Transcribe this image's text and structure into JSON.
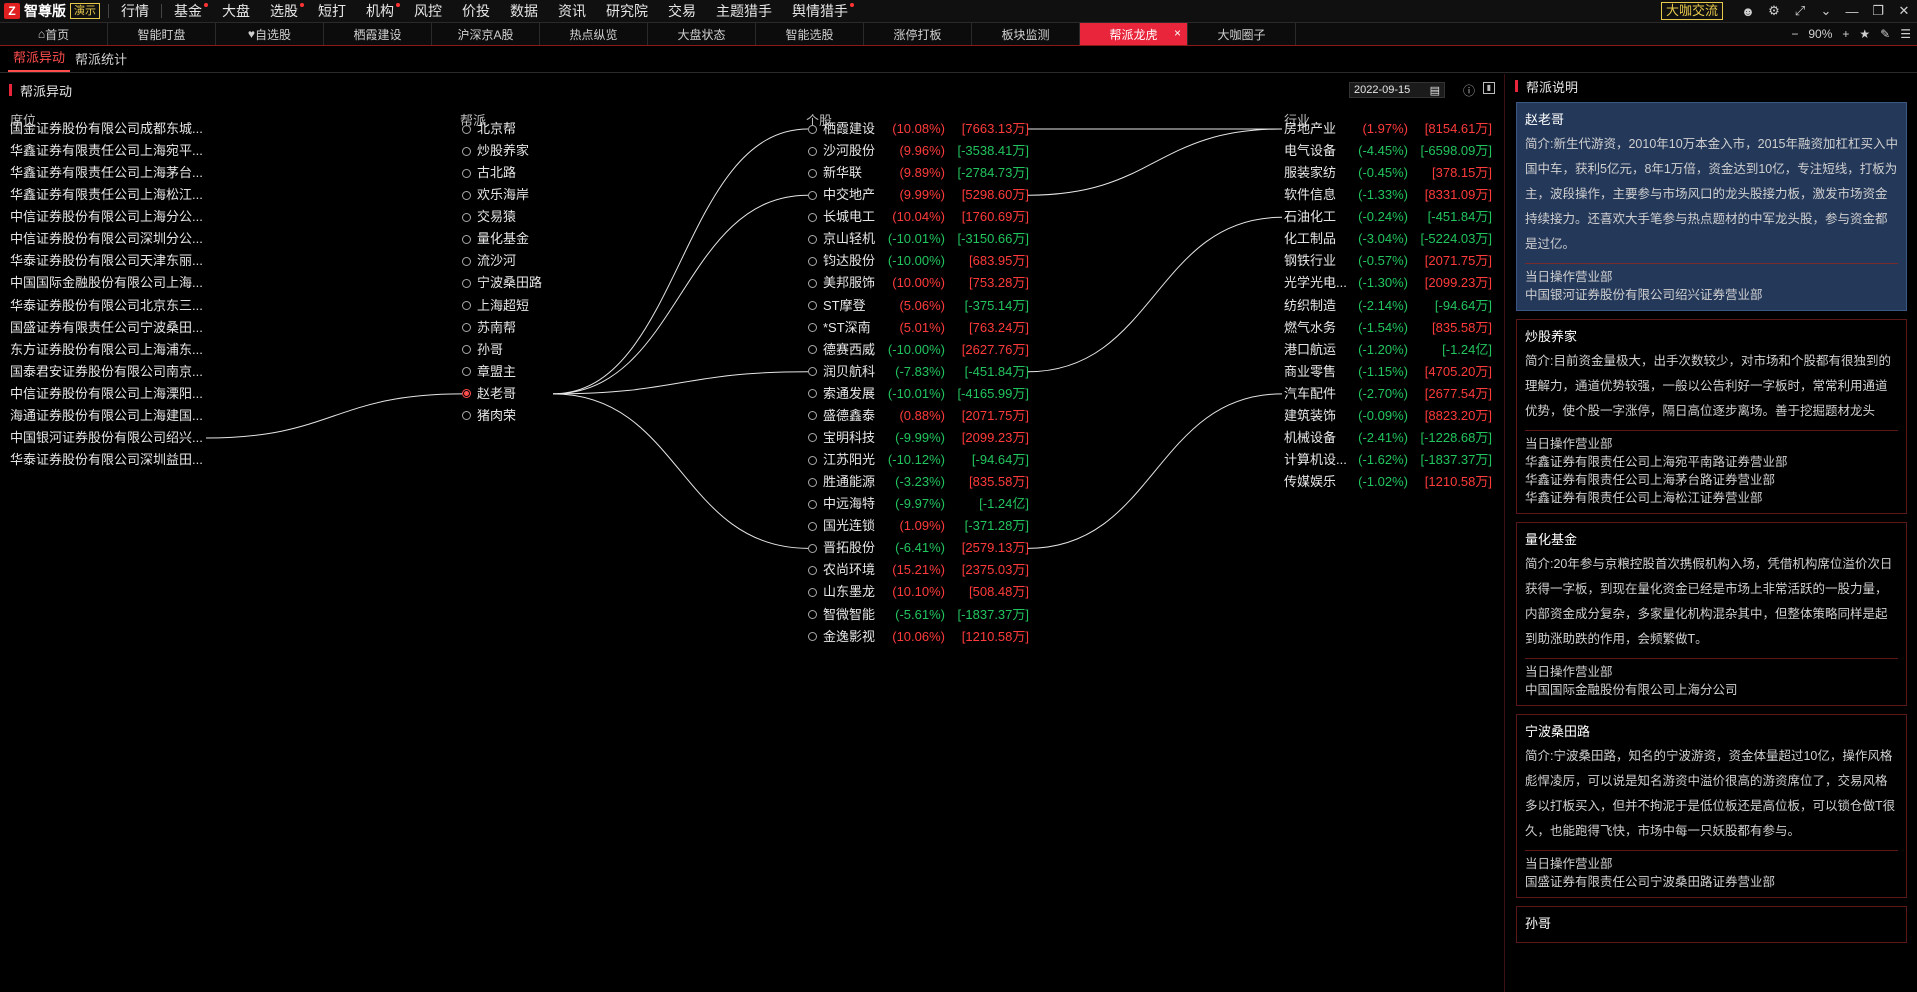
{
  "app": {
    "logo_mark": "Z",
    "name": "智尊版",
    "badge": "演示",
    "menu": [
      {
        "label": "行情",
        "dot": false
      },
      {
        "label": "基金",
        "dot": true
      },
      {
        "label": "大盘",
        "dot": false
      },
      {
        "label": "选股",
        "dot": true
      },
      {
        "label": "短打",
        "dot": false
      },
      {
        "label": "机构",
        "dot": true
      },
      {
        "label": "风控",
        "dot": false
      },
      {
        "label": "价投",
        "dot": false
      },
      {
        "label": "数据",
        "dot": false
      },
      {
        "label": "资讯",
        "dot": false
      },
      {
        "label": "研究院",
        "dot": false
      },
      {
        "label": "交易",
        "dot": false
      },
      {
        "label": "主题猎手",
        "dot": false
      },
      {
        "label": "舆情猎手",
        "dot": true
      }
    ],
    "exchange_label": "大咖交流"
  },
  "tabs": [
    "首页",
    "智能盯盘",
    "自选股",
    "栖霞建设",
    "沪深京A股",
    "热点纵览",
    "大盘状态",
    "智能选股",
    "涨停打板",
    "板块监测",
    "帮派龙虎",
    "大咖圈子"
  ],
  "active_tab_index": 10,
  "zoom": "90%",
  "subtabs": [
    "帮派异动",
    "帮派统计"
  ],
  "section_title": "帮派异动",
  "date": "2022-09-15",
  "columns": {
    "seat": "席位",
    "gang": "帮派",
    "stock": "个股",
    "industry": "行业"
  },
  "seats": [
    "国金证券股份有限公司成都东城...",
    "华鑫证券有限责任公司上海宛平...",
    "华鑫证券有限责任公司上海茅台...",
    "华鑫证券有限责任公司上海松江...",
    "中信证券股份有限公司上海分公...",
    "中信证券股份有限公司深圳分公...",
    "华泰证券股份有限公司天津东丽...",
    "中国国际金融股份有限公司上海...",
    "华泰证券股份有限公司北京东三...",
    "国盛证券有限责任公司宁波桑田...",
    "东方证券股份有限公司上海浦东...",
    "国泰君安证券股份有限公司南京...",
    "中信证券股份有限公司上海溧阳...",
    "海通证券股份有限公司上海建国...",
    "中国银河证券股份有限公司绍兴...",
    "华泰证券股份有限公司深圳益田..."
  ],
  "gangs": [
    "北京帮",
    "炒股养家",
    "古北路",
    "欢乐海岸",
    "交易猿",
    "量化基金",
    "流沙河",
    "宁波桑田路",
    "上海超短",
    "苏南帮",
    "孙哥",
    "章盟主",
    "赵老哥",
    "猪肉荣"
  ],
  "selected_gang_index": 12,
  "stocks": [
    {
      "name": "栖霞建设",
      "pct": "(10.08%)",
      "amt": "[7663.13万]",
      "pct_up": true,
      "amt_up": true
    },
    {
      "name": "沙河股份",
      "pct": "(9.96%)",
      "amt": "[-3538.41万]",
      "pct_up": true,
      "amt_up": false
    },
    {
      "name": "新华联",
      "pct": "(9.89%)",
      "amt": "[-2784.73万]",
      "pct_up": true,
      "amt_up": false
    },
    {
      "name": "中交地产",
      "pct": "(9.99%)",
      "amt": "[5298.60万]",
      "pct_up": true,
      "amt_up": true
    },
    {
      "name": "长城电工",
      "pct": "(10.04%)",
      "amt": "[1760.69万]",
      "pct_up": true,
      "amt_up": true
    },
    {
      "name": "京山轻机",
      "pct": "(-10.01%)",
      "amt": "[-3150.66万]",
      "pct_up": false,
      "amt_up": false
    },
    {
      "name": "钧达股份",
      "pct": "(-10.00%)",
      "amt": "[683.95万]",
      "pct_up": false,
      "amt_up": true
    },
    {
      "name": "美邦服饰",
      "pct": "(10.00%)",
      "amt": "[753.28万]",
      "pct_up": true,
      "amt_up": true
    },
    {
      "name": "ST摩登",
      "pct": "(5.06%)",
      "amt": "[-375.14万]",
      "pct_up": true,
      "amt_up": false
    },
    {
      "name": "*ST深南",
      "pct": "(5.01%)",
      "amt": "[763.24万]",
      "pct_up": true,
      "amt_up": true
    },
    {
      "name": "德赛西威",
      "pct": "(-10.00%)",
      "amt": "[2627.76万]",
      "pct_up": false,
      "amt_up": true
    },
    {
      "name": "润贝航科",
      "pct": "(-7.83%)",
      "amt": "[-451.84万]",
      "pct_up": false,
      "amt_up": false
    },
    {
      "name": "索通发展",
      "pct": "(-10.01%)",
      "amt": "[-4165.99万]",
      "pct_up": false,
      "amt_up": false
    },
    {
      "name": "盛德鑫泰",
      "pct": "(0.88%)",
      "amt": "[2071.75万]",
      "pct_up": true,
      "amt_up": true
    },
    {
      "name": "宝明科技",
      "pct": "(-9.99%)",
      "amt": "[2099.23万]",
      "pct_up": false,
      "amt_up": true
    },
    {
      "name": "江苏阳光",
      "pct": "(-10.12%)",
      "amt": "[-94.64万]",
      "pct_up": false,
      "amt_up": false
    },
    {
      "name": "胜通能源",
      "pct": "(-3.23%)",
      "amt": "[835.58万]",
      "pct_up": false,
      "amt_up": true
    },
    {
      "name": "中远海特",
      "pct": "(-9.97%)",
      "amt": "[-1.24亿]",
      "pct_up": false,
      "amt_up": false
    },
    {
      "name": "国光连锁",
      "pct": "(1.09%)",
      "amt": "[-371.28万]",
      "pct_up": true,
      "amt_up": false
    },
    {
      "name": "晋拓股份",
      "pct": "(-6.41%)",
      "amt": "[2579.13万]",
      "pct_up": false,
      "amt_up": true
    },
    {
      "name": "农尚环境",
      "pct": "(15.21%)",
      "amt": "[2375.03万]",
      "pct_up": true,
      "amt_up": true
    },
    {
      "name": "山东墨龙",
      "pct": "(10.10%)",
      "amt": "[508.48万]",
      "pct_up": true,
      "amt_up": true
    },
    {
      "name": "智微智能",
      "pct": "(-5.61%)",
      "amt": "[-1837.37万]",
      "pct_up": false,
      "amt_up": false
    },
    {
      "name": "金逸影视",
      "pct": "(10.06%)",
      "amt": "[1210.58万]",
      "pct_up": true,
      "amt_up": true
    }
  ],
  "industries": [
    {
      "name": "房地产业",
      "pct": "(1.97%)",
      "amt": "[8154.61万]",
      "pct_up": true,
      "amt_up": true
    },
    {
      "name": "电气设备",
      "pct": "(-4.45%)",
      "amt": "[-6598.09万]",
      "pct_up": false,
      "amt_up": false
    },
    {
      "name": "服装家纺",
      "pct": "(-0.45%)",
      "amt": "[378.15万]",
      "pct_up": false,
      "amt_up": true
    },
    {
      "name": "软件信息",
      "pct": "(-1.33%)",
      "amt": "[8331.09万]",
      "pct_up": false,
      "amt_up": true
    },
    {
      "name": "石油化工",
      "pct": "(-0.24%)",
      "amt": "[-451.84万]",
      "pct_up": false,
      "amt_up": false
    },
    {
      "name": "化工制品",
      "pct": "(-3.04%)",
      "amt": "[-5224.03万]",
      "pct_up": false,
      "amt_up": false
    },
    {
      "name": "钢铁行业",
      "pct": "(-0.57%)",
      "amt": "[2071.75万]",
      "pct_up": false,
      "amt_up": true
    },
    {
      "name": "光学光电...",
      "pct": "(-1.30%)",
      "amt": "[2099.23万]",
      "pct_up": false,
      "amt_up": true
    },
    {
      "name": "纺织制造",
      "pct": "(-2.14%)",
      "amt": "[-94.64万]",
      "pct_up": false,
      "amt_up": false
    },
    {
      "name": "燃气水务",
      "pct": "(-1.54%)",
      "amt": "[835.58万]",
      "pct_up": false,
      "amt_up": true
    },
    {
      "name": "港口航运",
      "pct": "(-1.20%)",
      "amt": "[-1.24亿]",
      "pct_up": false,
      "amt_up": false
    },
    {
      "name": "商业零售",
      "pct": "(-1.15%)",
      "amt": "[4705.20万]",
      "pct_up": false,
      "amt_up": true
    },
    {
      "name": "汽车配件",
      "pct": "(-2.70%)",
      "amt": "[2677.54万]",
      "pct_up": false,
      "amt_up": true
    },
    {
      "name": "建筑装饰",
      "pct": "(-0.09%)",
      "amt": "[8823.20万]",
      "pct_up": false,
      "amt_up": true
    },
    {
      "name": "机械设备",
      "pct": "(-2.41%)",
      "amt": "[-1228.68万]",
      "pct_up": false,
      "amt_up": false
    },
    {
      "name": "计算机设...",
      "pct": "(-1.62%)",
      "amt": "[-1837.37万]",
      "pct_up": false,
      "amt_up": false
    },
    {
      "name": "传媒娱乐",
      "pct": "(-1.02%)",
      "amt": "[1210.58万]",
      "pct_up": false,
      "amt_up": true
    }
  ],
  "links": {
    "seat_to_gang": [
      [
        14,
        12
      ]
    ],
    "gang_to_stock": [
      [
        12,
        0
      ],
      [
        12,
        3
      ],
      [
        12,
        11
      ],
      [
        12,
        19
      ]
    ],
    "stock_to_industry": [
      [
        0,
        0
      ],
      [
        3,
        0
      ],
      [
        11,
        4
      ],
      [
        19,
        12
      ]
    ]
  },
  "side": {
    "title": "帮派说明",
    "cards": [
      {
        "name": "赵老哥",
        "desc": "简介:新生代游资，2010年10万本金入市，2015年融资加杠杠买入中国中车，获利5亿元，8年1万倍，资金达到10亿，专注短线，打板为主，波段操作，主要参与市场风口的龙头股接力板，激发市场资金持续接力。还喜欢大手笔参与热点题材的中军龙头股，参与资金都是过亿。",
        "sub": "当日操作营业部",
        "branches": [
          "中国银河证券股份有限公司绍兴证券营业部"
        ]
      },
      {
        "name": "炒股养家",
        "desc": "简介:目前资金量极大，出手次数较少，对市场和个股都有很独到的理解力，通道优势较强，一般以公告利好一字板时，常常利用通道优势，使个股一字涨停，隔日高位逐步离场。善于挖掘题材龙头",
        "sub": "当日操作营业部",
        "branches": [
          "华鑫证券有限责任公司上海宛平南路证券营业部",
          "华鑫证券有限责任公司上海茅台路证券营业部",
          "华鑫证券有限责任公司上海松江证券营业部"
        ]
      },
      {
        "name": "量化基金",
        "desc": "简介:20年参与京粮控股首次携假机构入场，凭借机构席位溢价次日获得一字板，到现在量化资金已经是市场上非常活跃的一股力量，内部资金成分复杂，多家量化机构混杂其中，但整体策略同样是起到助涨助跌的作用，会频繁做T。",
        "sub": "当日操作营业部",
        "branches": [
          "中国国际金融股份有限公司上海分公司"
        ]
      },
      {
        "name": "宁波桑田路",
        "desc": "简介:宁波桑田路，知名的宁波游资，资金体量超过10亿，操作风格彪悍凌厉，可以说是知名游资中溢价很高的游资席位了，交易风格多以打板买入，但并不拘泥于是低位板还是高位板，可以锁仓做T很久，也能跑得飞快，市场中每一只妖股都有参与。",
        "sub": "当日操作营业部",
        "branches": [
          "国盛证券有限责任公司宁波桑田路证券营业部"
        ]
      },
      {
        "name": "孙哥",
        "desc": "",
        "sub": "",
        "branches": []
      }
    ]
  }
}
